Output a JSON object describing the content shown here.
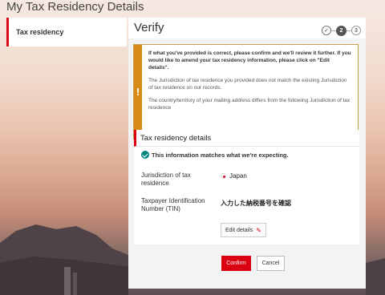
{
  "page": {
    "title": "My Tax Residency Details"
  },
  "sidebar": {
    "items": [
      {
        "label": "Tax residency"
      }
    ]
  },
  "verify": {
    "title": "Verify",
    "steps": [
      {
        "label": "✓",
        "state": "done"
      },
      {
        "label": "2",
        "state": "current"
      },
      {
        "label": "3",
        "state": "upcoming"
      }
    ]
  },
  "alert": {
    "icon": "warning-icon",
    "icon_glyph": "!",
    "accent_color": "#d88c18",
    "heading": "If what you've provided is correct, please confirm and we'll review it further. If you would like to amend your tax residency information, please click on \"Edit details\".",
    "message_1": "The Jurisdiction of tax residence you provided does not match the existing Jurisdiction of tax residence on our records.",
    "message_2": "The country/territory of your mailing address differs from the following Jurisdiction of tax residence"
  },
  "details": {
    "heading": "Tax residency details",
    "match_text": "This information matches what we're expecting.",
    "jurisdiction_label": "Jurisdiction of tax residence",
    "jurisdiction_value": "Japan",
    "tin_label": "Taxpayer Identification Number (TIN)",
    "tin_value": "入力した納税番号を確認",
    "edit_label": "Edit details"
  },
  "actions": {
    "confirm_label": "Confirm",
    "cancel_label": "Cancel",
    "brand_color": "#db0011"
  }
}
